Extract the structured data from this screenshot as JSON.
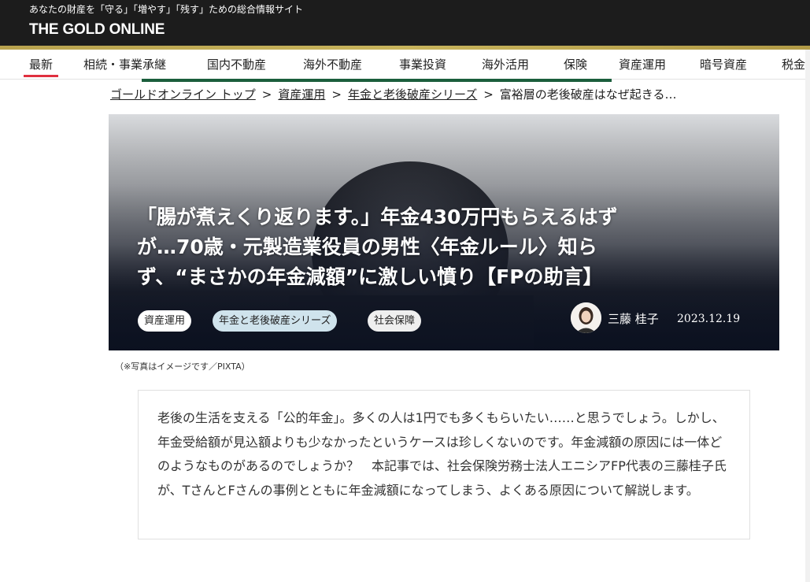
{
  "header": {
    "tagline": "あなたの財産を「守る」「増やす」「残す」ための総合情報サイト",
    "logo": "THE GOLD ONLINE"
  },
  "nav": {
    "items": [
      "最新",
      "相続・事業承継",
      "国内不動産",
      "海外不動産",
      "事業投資",
      "海外活用",
      "保険",
      "資産運用",
      "暗号資産",
      "税金"
    ],
    "active_index": 0
  },
  "breadcrumb": {
    "items": [
      "ゴールドオンライン トップ",
      "資産運用",
      "年金と老後破産シリーズ"
    ],
    "current": "富裕層の老後破産はなぜ起きる…",
    "separator": ">"
  },
  "article": {
    "title_lines": [
      "「腸が煮えくり返ります。」年金430万円もらえるはず",
      "が…70歳・元製造業役員の男性〈年金ルール〉知ら",
      "ず、“まさかの年金減額”に激しい憤り【FPの助言】"
    ],
    "tags": [
      "資産運用",
      "年金と老後破産シリーズ",
      "社会保障"
    ],
    "author": "三藤 桂子",
    "date": "2023.12.19",
    "photo_credit": "（※写真はイメージです／PIXTA）",
    "lead": "老後の生活を支える「公的年金」。多くの人は1円でも多くもらいたい……と思うでしょう。しかし、年金受給額が見込額よりも少なかったというケースは珍しくないのです。年金減額の原因には一体どのようなものがあるのでしょうか？　本記事では、社会保険労務士法人エニシアFP代表の三藤桂子氏が、TさんとFさんの事例とともに年金減額になってしまう、よくある原因について解説します。"
  },
  "colors": {
    "header_bg": "#1c1c1c",
    "gold_accent": "#c8b45c",
    "active_nav": "#e0303f",
    "nav_green": "#1b5e3c"
  }
}
